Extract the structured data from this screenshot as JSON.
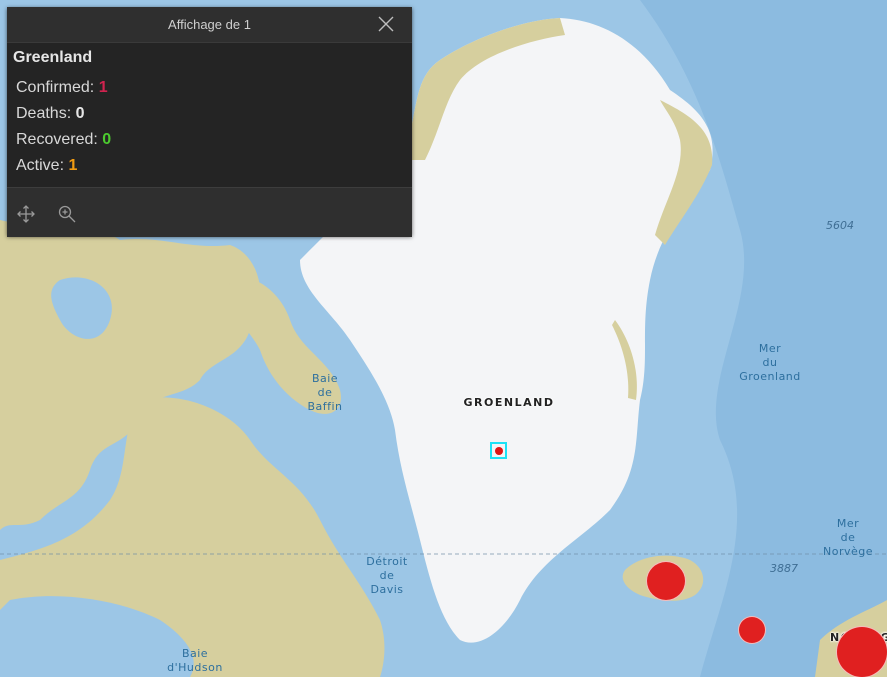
{
  "popup": {
    "header_title": "Affichage de 1",
    "feature_title": "Greenland",
    "fields": [
      {
        "label": "Confirmed:",
        "value": "1",
        "color": "#d0234f"
      },
      {
        "label": "Deaths:",
        "value": "0",
        "color": "#e6e6e6"
      },
      {
        "label": "Recovered:",
        "value": "0",
        "color": "#4ccb2f"
      },
      {
        "label": "Active:",
        "value": "1",
        "color": "#f29c12"
      }
    ],
    "actions": [
      "move-icon",
      "zoom-to-icon"
    ]
  },
  "map": {
    "labels": {
      "baie_baffin": [
        "Baie",
        "de",
        "Baffin"
      ],
      "groenland": "GROENLAND",
      "mer_groenland": [
        "Mer",
        "du",
        "Groenland"
      ],
      "mer_norvege": [
        "Mer",
        "de",
        "Norvège"
      ],
      "detroit_davis": [
        "Détroit",
        "de",
        "Davis"
      ],
      "baie_hudson": [
        "Baie",
        "d'Hudson"
      ],
      "norvege": "NORVÈG",
      "depth_5604": "5604",
      "depth_3887": "3887"
    },
    "colors": {
      "ocean": "#9cc6e6",
      "deep_ocean": "#8cbbe0",
      "ice": "#f4f5f7",
      "land": "#d6cf9e",
      "marker": "#e02020",
      "selection": "#1ee2f5"
    }
  }
}
